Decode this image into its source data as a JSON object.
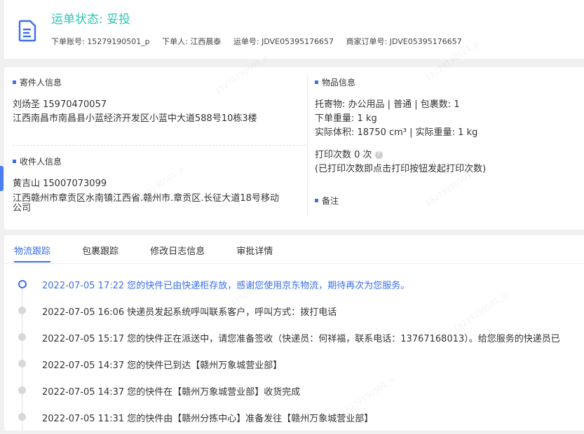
{
  "header": {
    "status": "运单状态: 妥投",
    "account": "下单账号: 15279190501_p",
    "orderer": "下单人: 江西晨泰",
    "waybill": "运单号: JDVE05395176657",
    "merchant_order": "商家订单号: JDVE05395176657"
  },
  "sender": {
    "title": "寄件人信息",
    "name_phone": "刘炀圣   15970470057",
    "address": "江西南昌市南昌县小蓝经济开发区小蓝中大道588号10栋3楼"
  },
  "receiver": {
    "title": "收件人信息",
    "name_phone": "黄吉山   15007073099",
    "address_line1": "江西赣州市章贡区水南镇江西省.赣州市.章贡区.长征大道18号移动",
    "address_line2": "公司"
  },
  "goods": {
    "title": "物品信息",
    "consignment": "托寄物:  办公用品 | 普通  |  包裹数:  1",
    "order_weight": "下单重量:   1 kg",
    "actual_volume": "实际体积:   18750 cm³ |  实际重量:   1 kg",
    "print_count": "打印次数   0 次",
    "print_note": "(已打印次数即点击打印按钮发起打印次数)"
  },
  "remark": {
    "title": "备注"
  },
  "tabs": [
    "物流跟踪",
    "包裹跟踪",
    "修改日志信息",
    "审批详情"
  ],
  "timeline": [
    "2022-07-05 17:22  您的快件已由快递柜存放，感谢您使用京东物流，期待再次为您服务。",
    "2022-07-05 16:06  快递员发起系统呼叫联系客户，呼叫方式：拨打电话",
    "2022-07-05 15:17  您的快件正在派送中，请您准备签收（快递员：何祥福，联系电话：13767168013）。给您服务的快递员已",
    "2022-07-05 14:37  您的快件已到达【赣州万象城营业部】",
    "2022-07-05 14:37  您的快件在【赣州万象城营业部】收货完成",
    "2022-07-05 11:31  您的快件由【赣州分拣中心】准备发往【赣州万象城营业部】"
  ],
  "watermark": "15279190501_p"
}
